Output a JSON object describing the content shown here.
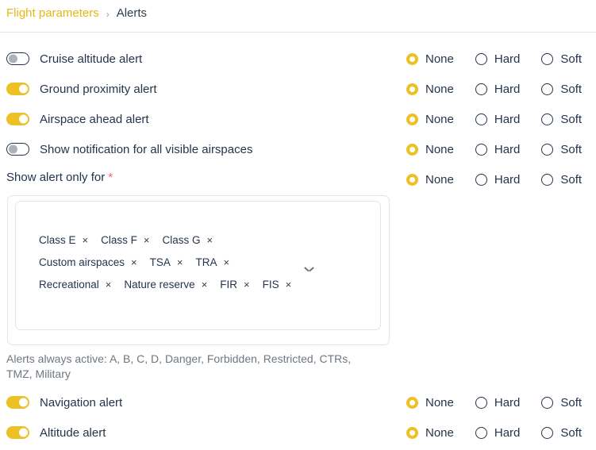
{
  "breadcrumb": {
    "parent": "Flight parameters",
    "separator": "›",
    "current": "Alerts"
  },
  "radio_options": [
    "None",
    "Hard",
    "Soft"
  ],
  "alert_rows": [
    {
      "label": "Cruise altitude alert",
      "toggle": "off",
      "selected": "None"
    },
    {
      "label": "Ground proximity alert",
      "toggle": "on",
      "selected": "None"
    },
    {
      "label": "Airspace ahead alert",
      "toggle": "on",
      "selected": "None"
    },
    {
      "label": "Show notification for all visible airspaces",
      "toggle": "off",
      "selected": "None"
    }
  ],
  "show_alert_only_for": {
    "label": "Show alert only for",
    "required_marker": "*",
    "selected": "None",
    "dropdown_icon": "chevron-down-icon",
    "tags": [
      {
        "label": "Class E",
        "remove": "×"
      },
      {
        "label": "Class F",
        "remove": "×"
      },
      {
        "label": "Class G",
        "remove": "×"
      },
      {
        "label": "Custom airspaces",
        "remove": "×"
      },
      {
        "label": "TSA",
        "remove": "×"
      },
      {
        "label": "TRA",
        "remove": "×"
      },
      {
        "label": "Recreational",
        "remove": "×"
      },
      {
        "label": "Nature reserve",
        "remove": "×"
      },
      {
        "label": "FIR",
        "remove": "×"
      },
      {
        "label": "FIS",
        "remove": "×"
      }
    ],
    "helper_text": "Alerts always active: A, B, C, D, Danger, Forbidden, Restricted, CTRs, TMZ, Military"
  },
  "bottom_rows": [
    {
      "label": "Navigation alert",
      "toggle": "on",
      "selected": "None"
    },
    {
      "label": "Altitude alert",
      "toggle": "on",
      "selected": "None"
    }
  ],
  "colors": {
    "accent": "#edc024",
    "link": "#e8b711",
    "text": "#24344d",
    "muted": "#6e7781",
    "required": "#f2607a",
    "border": "#e3e5e8"
  }
}
